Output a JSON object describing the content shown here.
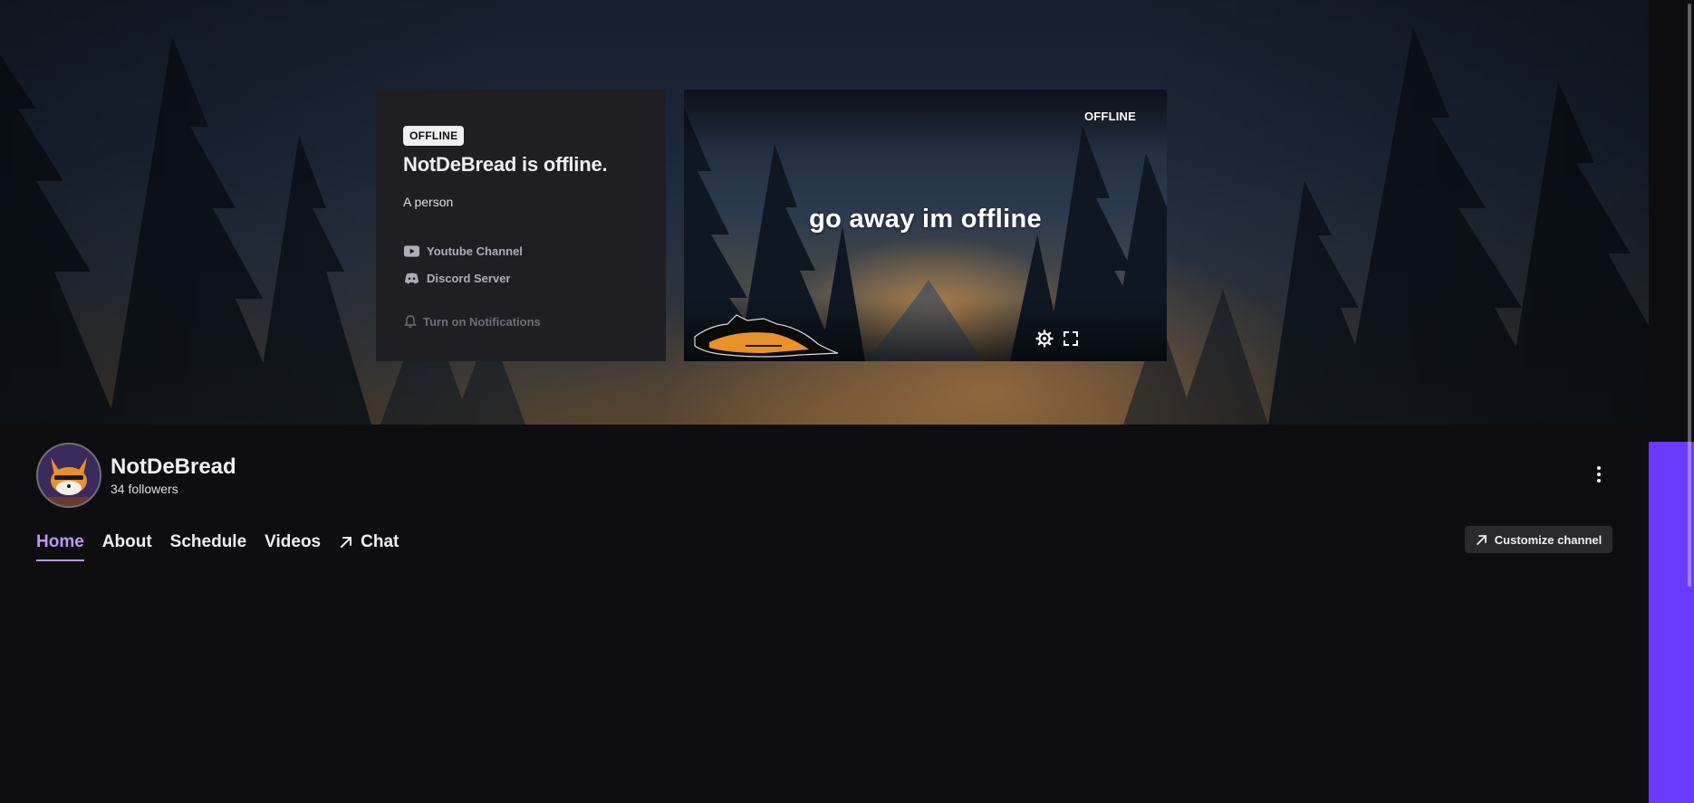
{
  "offline_card": {
    "badge": "OFFLINE",
    "title": "NotDeBread is offline.",
    "description": "A person",
    "links": [
      {
        "label": "Youtube Channel",
        "icon": "youtube-icon"
      },
      {
        "label": "Discord Server",
        "icon": "discord-icon"
      }
    ],
    "notifications_label": "Turn on Notifications"
  },
  "player": {
    "status": "OFFLINE",
    "message": "go away im offline",
    "controls": [
      "gear-icon",
      "fullscreen-icon"
    ]
  },
  "channel": {
    "name": "NotDeBread",
    "followers": "34 followers",
    "avatar": "fox-avatar"
  },
  "tabs": [
    {
      "label": "Home",
      "active": true
    },
    {
      "label": "About",
      "active": false
    },
    {
      "label": "Schedule",
      "active": false
    },
    {
      "label": "Videos",
      "active": false
    },
    {
      "label": "Chat",
      "active": false,
      "icon": "external-arrow-icon"
    }
  ],
  "actions": {
    "customize_label": "Customize channel"
  },
  "colors": {
    "accent": "#bf94ff",
    "brand_purple": "#6a3aff",
    "background": "#0e0e10",
    "card": "#1f1f23"
  }
}
